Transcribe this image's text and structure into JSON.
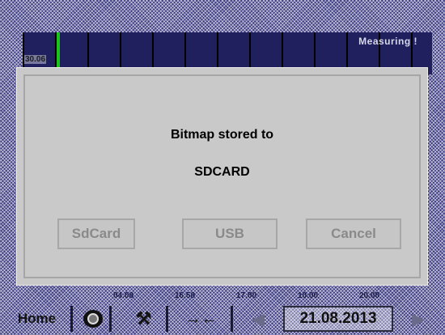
{
  "header": {
    "status_text": "Measuring !",
    "left_value": "30.06"
  },
  "dialog": {
    "line1": "Bitmap stored to",
    "line2": "SDCARD",
    "buttons": {
      "sdcard": "SdCard",
      "usb": "USB",
      "cancel": "Cancel"
    }
  },
  "value_labels": [
    "04.08",
    "16.58",
    "17.00",
    "10.00",
    "20.00"
  ],
  "bottom_bar": {
    "home": "Home",
    "camera_icon": "camera-icon",
    "tool_icon": "wrench-icon",
    "arrows_icon": "arrows-icon",
    "back_icon": "arrow-left-icon",
    "date": "21.08.2013",
    "forward_icon": "arrow-right-icon"
  },
  "colors": {
    "accent_green": "#1bc41b",
    "background": "#3d3c82",
    "dialog": "#c9c9c9"
  }
}
